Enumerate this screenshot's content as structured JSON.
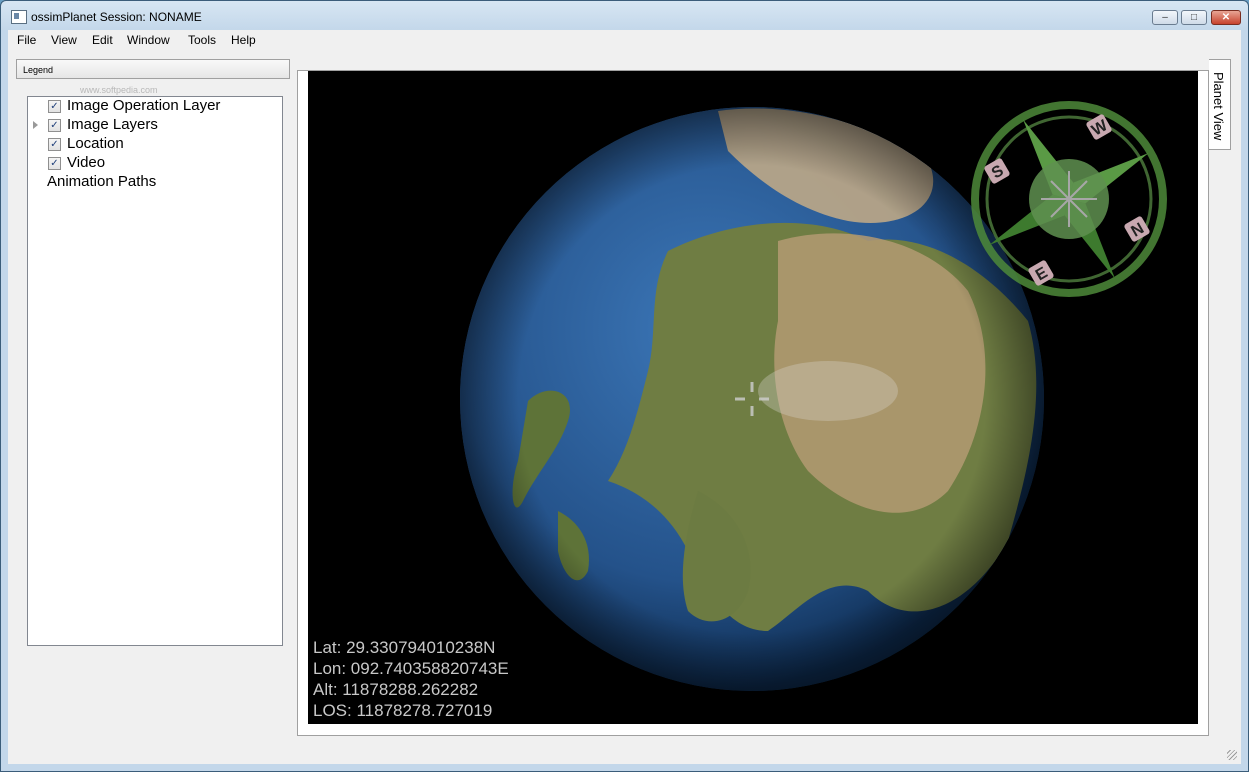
{
  "window": {
    "title": "ossimPlanet Session: NONAME",
    "controls": {
      "minimize": "–",
      "maximize": "□",
      "close": "✕"
    }
  },
  "menu": [
    "File",
    "View",
    "Edit",
    "Window",
    "Tools",
    "Help"
  ],
  "watermark": "www.softpedia.com",
  "legend": {
    "title": "Legend",
    "items": [
      {
        "label": "Image Operation Layer",
        "checked": true,
        "expandable": false
      },
      {
        "label": "Image Layers",
        "checked": true,
        "expandable": true
      },
      {
        "label": "Location",
        "checked": true,
        "expandable": false
      },
      {
        "label": "Video",
        "checked": true,
        "expandable": false
      },
      {
        "label": "Animation Paths",
        "checked": null,
        "expandable": false
      }
    ]
  },
  "tab": {
    "label": "Planet View"
  },
  "compass": {
    "letters": [
      "N",
      "E",
      "S",
      "W"
    ]
  },
  "hud": {
    "lat": "Lat: 29.330794010238N",
    "lon": "Lon: 092.740358820743E",
    "alt": "Alt: 11878288.262282",
    "los": "LOS: 11878278.727019"
  },
  "colors": {
    "ocean": "#2f5f9a",
    "land": "#6f7d43",
    "desert": "#b49a72",
    "compass": "#4d8a3a"
  }
}
